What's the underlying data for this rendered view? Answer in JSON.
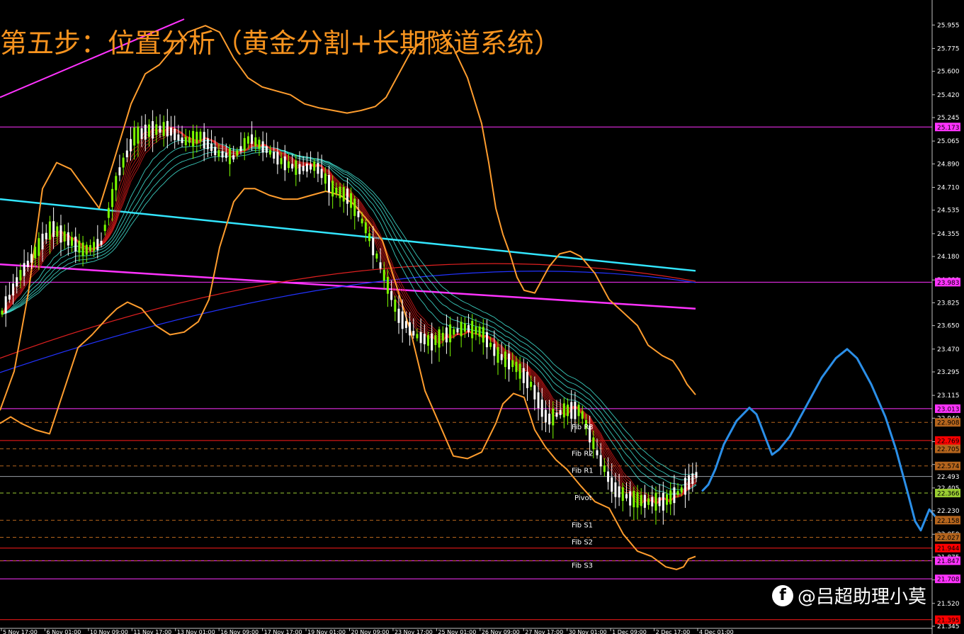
{
  "title": "第五步：位置分析（黄金分割+长期隧道系统）",
  "watermark": {
    "text": "@吕超助理小莫"
  },
  "colors": {
    "background": "#000000",
    "bull": "#ffffff",
    "bear": "#7cfc00",
    "bollinger": "#ff9d2e",
    "tunnel_fast": "#d41a1a",
    "tunnel_slow": "#40e0d0",
    "cyan_trend": "#33e6ff",
    "magenta_trend": "#ff33ff",
    "projection": "#2b8fe8",
    "text_orange": "#f7931e"
  },
  "chart_data": {
    "type": "candlestick",
    "y_axis": {
      "ylim": [
        21.345,
        26.0
      ],
      "ticks": [
        "25.955",
        "25.775",
        "25.600",
        "25.420",
        "25.245",
        "25.065",
        "24.890",
        "24.710",
        "24.535",
        "24.355",
        "24.180",
        "24.000",
        "23.825",
        "23.650",
        "23.470",
        "23.295",
        "23.115",
        "22.940",
        "22.760",
        "22.585",
        "22.405",
        "22.230",
        "22.050",
        "21.875",
        "21.700",
        "21.520",
        "21.345"
      ]
    },
    "x_axis": {
      "ticks": [
        "5 Nov 17:00",
        "6 Nov 01:00",
        "10 Nov 09:00",
        "11 Nov 17:00",
        "13 Nov 01:00",
        "16 Nov 09:00",
        "17 Nov 17:00",
        "19 Nov 01:00",
        "20 Nov 09:00",
        "23 Nov 17:00",
        "25 Nov 01:00",
        "26 Nov 09:00",
        "27 Nov 17:00",
        "30 Nov 01:00",
        "1 Dec 09:00",
        "2 Dec 17:00",
        "4 Dec 01:00"
      ]
    },
    "price_tags": [
      {
        "value": 25.173,
        "label": "25.173",
        "bg": "#ff33ff",
        "fg": "#000000"
      },
      {
        "value": 23.983,
        "label": "23.983",
        "bg": "#ff33ff",
        "fg": "#000000"
      },
      {
        "value": 23.013,
        "label": "23.013",
        "bg": "#ff33ff",
        "fg": "#000000"
      },
      {
        "value": 22.908,
        "label": "22.908",
        "bg": "#b5651d",
        "fg": "#000000"
      },
      {
        "value": 22.769,
        "label": "22.769",
        "bg": "#ff0000",
        "fg": "#000000"
      },
      {
        "value": 22.705,
        "label": "22.705",
        "bg": "#b5651d",
        "fg": "#000000"
      },
      {
        "value": 22.574,
        "label": "22.574",
        "bg": "#b5651d",
        "fg": "#000000"
      },
      {
        "value": 22.493,
        "label": "22.493",
        "bg": "#000000",
        "fg": "#ffffff"
      },
      {
        "value": 22.366,
        "label": "22.366",
        "bg": "#9acd32",
        "fg": "#000000"
      },
      {
        "value": 22.158,
        "label": "22.158",
        "bg": "#b5651d",
        "fg": "#000000"
      },
      {
        "value": 22.027,
        "label": "22.027",
        "bg": "#b5651d",
        "fg": "#000000"
      },
      {
        "value": 21.944,
        "label": "21.944",
        "bg": "#ff0000",
        "fg": "#000000"
      },
      {
        "value": 21.847,
        "label": "21.847",
        "bg": "#ff33ff",
        "fg": "#000000"
      },
      {
        "value": 21.708,
        "label": "21.708",
        "bg": "#ff33ff",
        "fg": "#000000"
      },
      {
        "value": 21.395,
        "label": "21.395",
        "bg": "#ff0000",
        "fg": "#000000"
      }
    ],
    "fib_levels": [
      {
        "label": "Fib R3",
        "value": 22.908
      },
      {
        "label": "Fib R2",
        "value": 22.705
      },
      {
        "label": "Fib R1",
        "value": 22.574
      },
      {
        "label": "Pivot",
        "value": 22.366
      },
      {
        "label": "Fib S1",
        "value": 22.158
      },
      {
        "label": "Fib S2",
        "value": 22.027
      },
      {
        "label": "Fib S3",
        "value": 21.847
      }
    ],
    "magenta_levels": [
      25.173,
      23.983,
      23.013,
      21.847,
      21.708
    ],
    "red_levels": [
      22.769,
      21.944,
      21.395
    ],
    "current_price": 22.493,
    "anchors": [
      {
        "o": 23.72,
        "c": 23.78
      },
      {
        "o": 23.98,
        "c": 24.05
      },
      {
        "o": 24.2,
        "c": 24.22
      },
      {
        "o": 24.42,
        "c": 24.38
      },
      {
        "o": 24.35,
        "c": 24.28
      },
      {
        "o": 24.25,
        "c": 24.2
      },
      {
        "o": 24.22,
        "c": 24.35
      },
      {
        "o": 24.6,
        "c": 25.0
      },
      {
        "o": 25.02,
        "c": 25.18
      },
      {
        "o": 25.1,
        "c": 25.2
      },
      {
        "o": 25.22,
        "c": 25.1
      },
      {
        "o": 25.1,
        "c": 25.02
      },
      {
        "o": 25.05,
        "c": 25.15
      },
      {
        "o": 25.1,
        "c": 24.85
      },
      {
        "o": 24.88,
        "c": 25.0
      },
      {
        "o": 25.08,
        "c": 25.1
      },
      {
        "o": 25.05,
        "c": 24.95
      },
      {
        "o": 24.92,
        "c": 24.88
      },
      {
        "o": 24.88,
        "c": 24.82
      },
      {
        "o": 24.85,
        "c": 24.9
      },
      {
        "o": 24.8,
        "c": 24.6
      },
      {
        "o": 24.62,
        "c": 24.65
      },
      {
        "o": 24.6,
        "c": 24.2
      },
      {
        "o": 24.2,
        "c": 23.95
      },
      {
        "o": 23.9,
        "c": 23.55
      },
      {
        "o": 23.6,
        "c": 23.55
      },
      {
        "o": 23.55,
        "c": 23.5
      },
      {
        "o": 23.55,
        "c": 23.62
      },
      {
        "o": 23.65,
        "c": 23.62
      },
      {
        "o": 23.62,
        "c": 23.58
      },
      {
        "o": 23.55,
        "c": 23.3
      },
      {
        "o": 23.3,
        "c": 23.4
      },
      {
        "o": 23.4,
        "c": 23.0
      },
      {
        "o": 23.0,
        "c": 22.85
      },
      {
        "o": 22.85,
        "c": 23.15
      },
      {
        "o": 23.1,
        "c": 22.9
      },
      {
        "o": 22.8,
        "c": 22.55
      },
      {
        "o": 22.5,
        "c": 22.3
      },
      {
        "o": 22.3,
        "c": 22.35
      },
      {
        "o": 22.3,
        "c": 22.3
      },
      {
        "o": 22.32,
        "c": 22.28
      },
      {
        "o": 22.3,
        "c": 22.45
      },
      {
        "o": 22.46,
        "c": 22.55
      }
    ],
    "bollinger_upper": [
      [
        0,
        23.0
      ],
      [
        20,
        23.3
      ],
      [
        40,
        23.9
      ],
      [
        60,
        24.7
      ],
      [
        80,
        24.9
      ],
      [
        100,
        24.85
      ],
      [
        120,
        24.7
      ],
      [
        140,
        24.55
      ],
      [
        160,
        24.9
      ],
      [
        185,
        25.35
      ],
      [
        205,
        25.58
      ],
      [
        225,
        25.65
      ],
      [
        245,
        25.78
      ],
      [
        265,
        25.9
      ],
      [
        290,
        25.95
      ],
      [
        310,
        25.9
      ],
      [
        330,
        25.7
      ],
      [
        350,
        25.55
      ],
      [
        370,
        25.48
      ],
      [
        390,
        25.45
      ],
      [
        410,
        25.42
      ],
      [
        430,
        25.35
      ],
      [
        450,
        25.32
      ],
      [
        470,
        25.3
      ],
      [
        490,
        25.28
      ],
      [
        510,
        25.3
      ],
      [
        530,
        25.33
      ],
      [
        545,
        25.4
      ],
      [
        560,
        25.55
      ],
      [
        580,
        25.75
      ],
      [
        600,
        25.85
      ],
      [
        625,
        25.88
      ],
      [
        640,
        25.78
      ],
      [
        660,
        25.55
      ],
      [
        680,
        25.2
      ],
      [
        690,
        24.9
      ],
      [
        700,
        24.55
      ],
      [
        710,
        24.35
      ],
      [
        720,
        24.2
      ],
      [
        730,
        24.02
      ],
      [
        740,
        23.92
      ],
      [
        755,
        23.9
      ],
      [
        765,
        24.0
      ],
      [
        775,
        24.1
      ],
      [
        790,
        24.2
      ],
      [
        805,
        24.22
      ],
      [
        820,
        24.18
      ],
      [
        840,
        24.05
      ],
      [
        860,
        23.85
      ],
      [
        880,
        23.75
      ],
      [
        900,
        23.65
      ],
      [
        915,
        23.5
      ],
      [
        935,
        23.42
      ],
      [
        950,
        23.38
      ],
      [
        960,
        23.3
      ],
      [
        970,
        23.2
      ],
      [
        982,
        23.12
      ]
    ],
    "bollinger_lower": [
      [
        0,
        22.9
      ],
      [
        15,
        22.95
      ],
      [
        30,
        22.9
      ],
      [
        50,
        22.85
      ],
      [
        70,
        22.82
      ],
      [
        90,
        23.15
      ],
      [
        110,
        23.48
      ],
      [
        130,
        23.58
      ],
      [
        150,
        23.7
      ],
      [
        165,
        23.78
      ],
      [
        180,
        23.83
      ],
      [
        200,
        23.78
      ],
      [
        220,
        23.65
      ],
      [
        240,
        23.58
      ],
      [
        260,
        23.6
      ],
      [
        280,
        23.68
      ],
      [
        295,
        23.85
      ],
      [
        310,
        24.25
      ],
      [
        330,
        24.6
      ],
      [
        345,
        24.7
      ],
      [
        360,
        24.7
      ],
      [
        380,
        24.65
      ],
      [
        400,
        24.62
      ],
      [
        420,
        24.62
      ],
      [
        440,
        24.65
      ],
      [
        460,
        24.68
      ],
      [
        480,
        24.65
      ],
      [
        500,
        24.58
      ],
      [
        520,
        24.45
      ],
      [
        540,
        24.3
      ],
      [
        560,
        23.95
      ],
      [
        580,
        23.6
      ],
      [
        600,
        23.15
      ],
      [
        620,
        22.9
      ],
      [
        640,
        22.65
      ],
      [
        660,
        22.63
      ],
      [
        680,
        22.68
      ],
      [
        700,
        22.9
      ],
      [
        710,
        23.05
      ],
      [
        725,
        23.13
      ],
      [
        740,
        23.1
      ],
      [
        755,
        22.85
      ],
      [
        770,
        22.72
      ],
      [
        785,
        22.62
      ],
      [
        800,
        22.55
      ],
      [
        820,
        22.42
      ],
      [
        840,
        22.3
      ],
      [
        860,
        22.25
      ],
      [
        880,
        22.05
      ],
      [
        900,
        21.92
      ],
      [
        920,
        21.88
      ],
      [
        940,
        21.8
      ],
      [
        955,
        21.78
      ],
      [
        965,
        21.8
      ],
      [
        972,
        21.86
      ],
      [
        982,
        21.88
      ]
    ],
    "magenta_trend": {
      "start": [
        0,
        24.12
      ],
      "end": [
        982,
        23.78
      ]
    },
    "magenta_upper_trend": {
      "start": [
        0,
        25.4
      ],
      "end": [
        260,
        26.0
      ]
    },
    "cyan_trend": {
      "start": [
        0,
        24.62
      ],
      "end": [
        982,
        24.07
      ]
    },
    "red_long": {
      "start": [
        0,
        23.4
      ],
      "end": [
        982,
        23.99
      ],
      "peak": [
        520,
        24.33
      ]
    },
    "blue_long": {
      "start": [
        0,
        23.29
      ],
      "end": [
        982,
        23.98
      ],
      "peak": [
        560,
        24.22
      ]
    },
    "projection_path": [
      [
        992,
        22.385
      ],
      [
        1000,
        22.43
      ],
      [
        1010,
        22.55
      ],
      [
        1022,
        22.74
      ],
      [
        1040,
        22.92
      ],
      [
        1058,
        23.02
      ],
      [
        1068,
        22.97
      ],
      [
        1080,
        22.8
      ],
      [
        1090,
        22.66
      ],
      [
        1100,
        22.7
      ],
      [
        1115,
        22.8
      ],
      [
        1135,
        23.0
      ],
      [
        1160,
        23.25
      ],
      [
        1180,
        23.4
      ],
      [
        1196,
        23.47
      ],
      [
        1210,
        23.4
      ],
      [
        1230,
        23.2
      ],
      [
        1250,
        22.95
      ],
      [
        1265,
        22.7
      ],
      [
        1280,
        22.4
      ],
      [
        1292,
        22.15
      ],
      [
        1300,
        22.08
      ],
      [
        1312,
        22.24
      ],
      [
        1328,
        22.14
      ]
    ]
  }
}
